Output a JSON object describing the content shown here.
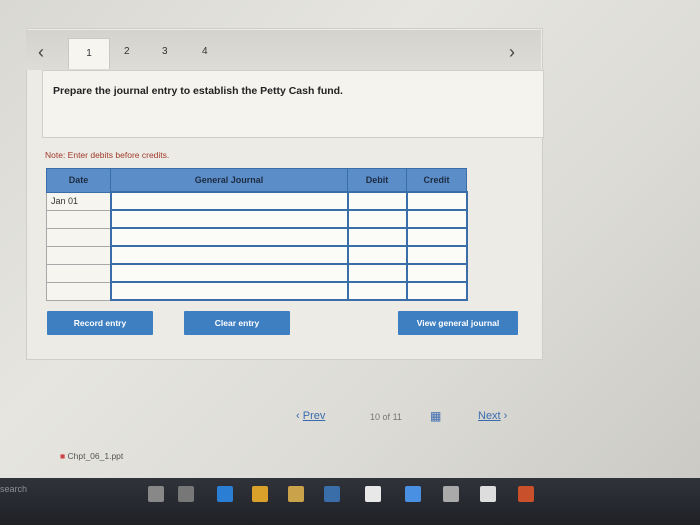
{
  "tabs": {
    "prev_icon": "chevron-left-icon",
    "next_icon": "chevron-right-icon",
    "items": [
      "1",
      "2",
      "3",
      "4"
    ]
  },
  "question": {
    "text": "Prepare the journal entry to establish the Petty Cash fund."
  },
  "note": "Note: Enter debits before credits.",
  "table": {
    "headers": [
      "Date",
      "General Journal",
      "Debit",
      "Credit"
    ],
    "rows": [
      [
        "Jan 01",
        "",
        "",
        ""
      ],
      [
        "",
        "",
        "",
        ""
      ],
      [
        "",
        "",
        "",
        ""
      ],
      [
        "",
        "",
        "",
        ""
      ],
      [
        "",
        "",
        "",
        ""
      ],
      [
        "",
        "",
        "",
        ""
      ]
    ]
  },
  "buttons": {
    "record": "Record entry",
    "clear": "Clear entry",
    "view": "View general journal"
  },
  "pager": {
    "prev": "Prev",
    "position": "10",
    "of": "of",
    "total": "11",
    "next": "Next"
  },
  "download": {
    "file": "Chpt_06_1.ppt"
  },
  "taskbar": {
    "search": "search"
  }
}
